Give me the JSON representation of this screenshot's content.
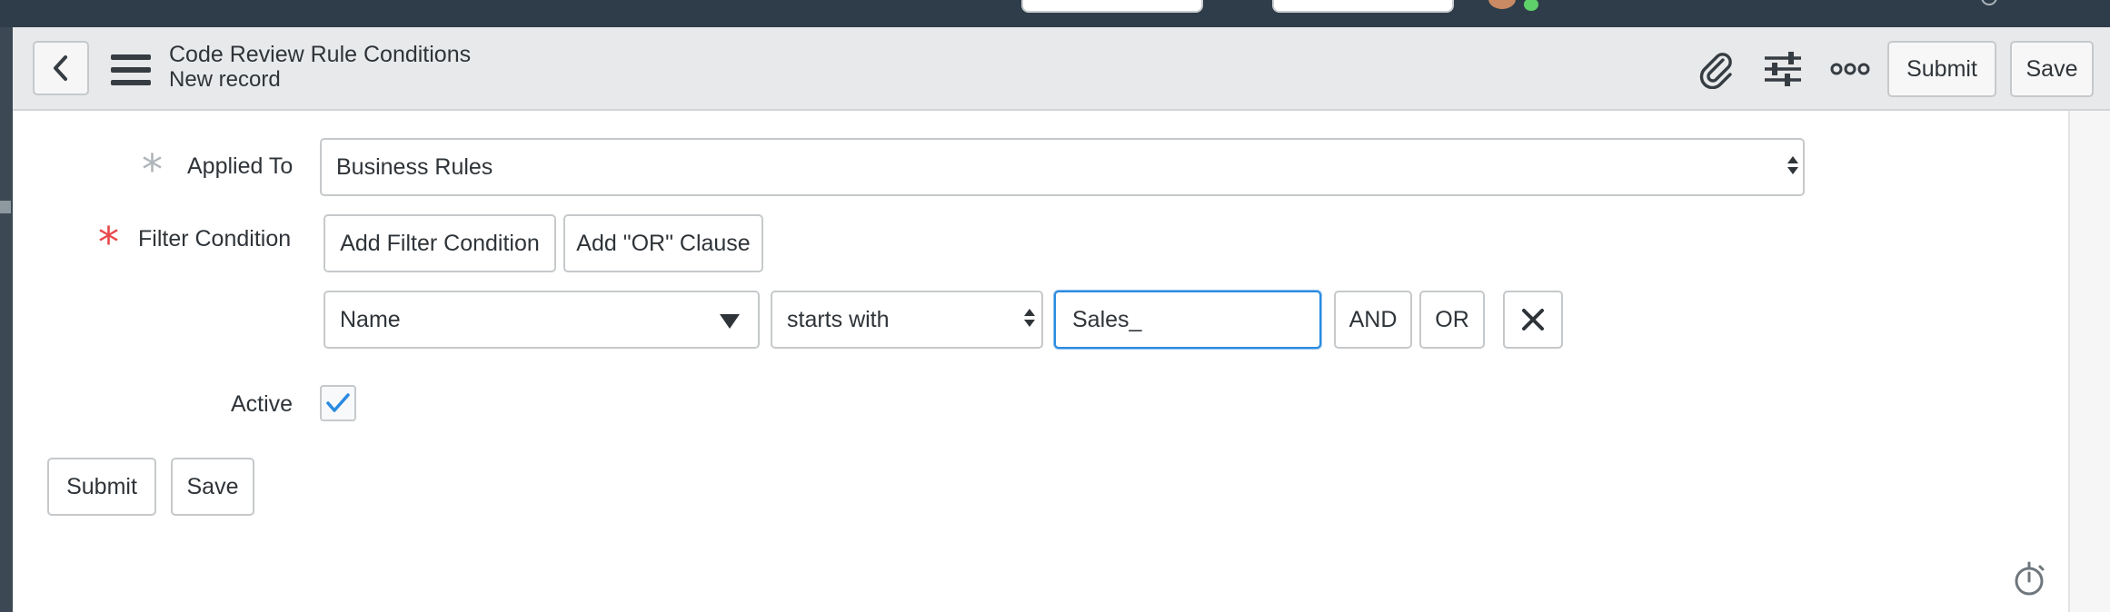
{
  "header": {
    "title": "Code Review Rule Conditions",
    "subtitle": "New record",
    "submit_label": "Submit",
    "save_label": "Save"
  },
  "icons": {
    "back": "chevron-left-icon",
    "menu": "hamburger-menu-icon",
    "attachment": "paperclip-icon",
    "personalize": "sliders-icon",
    "more": "more-options-icon",
    "remove": "close-icon",
    "check": "checkmark-icon",
    "timer": "stopwatch-icon"
  },
  "form": {
    "applied_to": {
      "label": "Applied To",
      "value": "Business Rules",
      "required": true
    },
    "filter_condition": {
      "label": "Filter Condition",
      "required": true,
      "add_filter_label": "Add Filter Condition",
      "add_or_label": "Add \"OR\" Clause",
      "field_value": "Name",
      "operator_value": "starts with",
      "input_value": "Sales_",
      "and_label": "AND",
      "or_label": "OR"
    },
    "active": {
      "label": "Active",
      "checked": true
    }
  },
  "footer": {
    "submit_label": "Submit",
    "save_label": "Save"
  },
  "colors": {
    "required_filled": "#e8474b",
    "required_empty": "#b0b5b9",
    "focus": "#2a8ae0",
    "check": "#2a8ae0",
    "header_bg": "#e8e9ea",
    "topbar_bg": "#2e3d49"
  }
}
